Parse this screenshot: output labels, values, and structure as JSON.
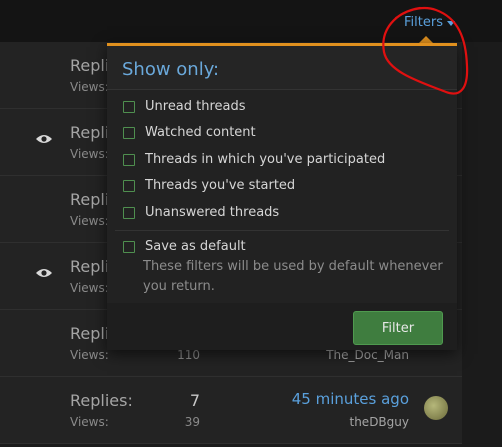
{
  "header": {
    "filters_label": "Filters"
  },
  "dropdown": {
    "title": "Show only:",
    "options": [
      {
        "label": "Unread threads"
      },
      {
        "label": "Watched content"
      },
      {
        "label": "Threads in which you've participated"
      },
      {
        "label": "Threads you've started"
      },
      {
        "label": "Unanswered threads"
      }
    ],
    "save_default": {
      "label": "Save as default",
      "hint": "These filters will be used by default whenever you return."
    },
    "filter_button": "Filter"
  },
  "threads": [
    {
      "replies_label": "Replies:",
      "views_label": "Views:",
      "replies": "",
      "views": "",
      "time": "",
      "user": "",
      "watched": false
    },
    {
      "replies_label": "Replies:",
      "views_label": "Views:",
      "replies": "",
      "views": "",
      "time": "",
      "user": "",
      "watched": true
    },
    {
      "replies_label": "Replies:",
      "views_label": "Views:",
      "replies": "",
      "views": "",
      "time": "",
      "user": "",
      "watched": false
    },
    {
      "replies_label": "Replies:",
      "views_label": "Views:",
      "replies": "",
      "views": "",
      "time": "",
      "user": "",
      "watched": true
    },
    {
      "replies_label": "Replies:",
      "views_label": "Views:",
      "replies": "",
      "views": "110",
      "time": "",
      "user": "The_Doc_Man",
      "watched": false
    },
    {
      "replies_label": "Replies:",
      "views_label": "Views:",
      "replies": "7",
      "views": "39",
      "time": "45 minutes ago",
      "user": "theDBguy",
      "watched": false
    }
  ],
  "colors": {
    "accent": "#5aa0dc",
    "menu_border": "#e0901e",
    "button": "#3f7d3f",
    "annotation": "#e01010"
  }
}
